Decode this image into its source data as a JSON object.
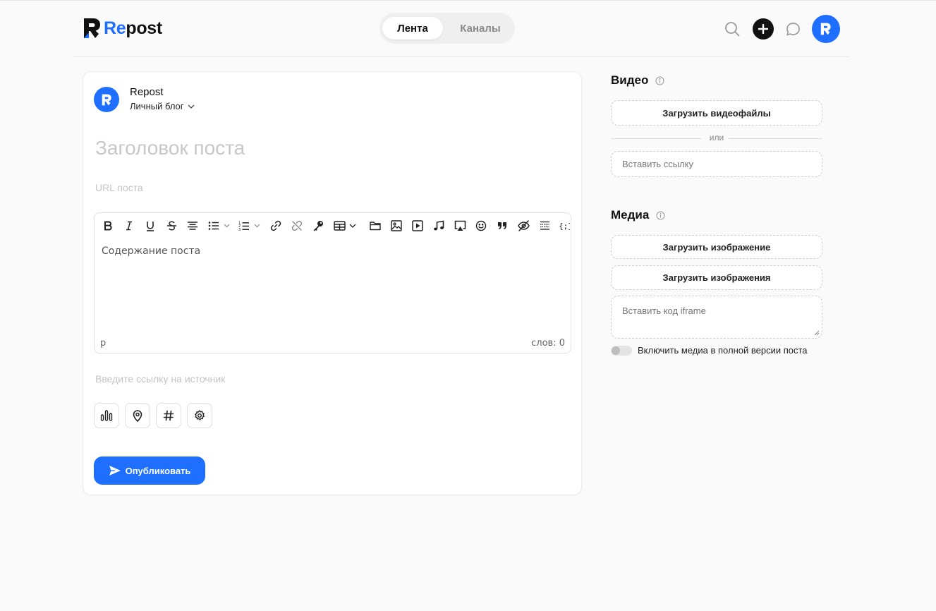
{
  "header": {
    "logo_re": "Re",
    "logo_post": "post",
    "tabs": [
      {
        "label": "Лента",
        "active": true
      },
      {
        "label": "Каналы",
        "active": false
      }
    ]
  },
  "editor_card": {
    "author_name": "Repost",
    "blog_select": "Личный блог",
    "title_placeholder": "Заголовок поста",
    "url_placeholder": "URL поста",
    "toolbar_icons": [
      "bold-icon",
      "italic-icon",
      "underline-icon",
      "strikethrough-icon",
      "align-center-icon",
      "bullet-list-icon",
      "numbered-list-icon",
      "link-icon",
      "unlink-icon",
      "key-icon",
      "table-icon",
      "folder-icon",
      "image-icon",
      "video-icon",
      "music-icon",
      "airplay-icon",
      "emoji-icon",
      "quote-icon",
      "hide-icon",
      "preformatted-icon",
      "code-icon"
    ],
    "content_placeholder": "Содержание поста",
    "status_path": "p",
    "word_count": "слов: 0",
    "source_placeholder": "Введите ссылку на источник",
    "option_icons": [
      "poll-icon",
      "location-icon",
      "hashtag-icon",
      "settings-icon"
    ],
    "publish_label": "Опубликовать"
  },
  "video_section": {
    "title": "Видео",
    "upload_label": "Загрузить видеофайлы",
    "or_label": "или",
    "link_placeholder": "Вставить ссылку"
  },
  "media_section": {
    "title": "Медиа",
    "upload_image_label": "Загрузить изображение",
    "upload_images_label": "Загрузить изображения",
    "iframe_placeholder": "Вставить код iframe",
    "toggle_label": "Включить медиа в полной версии поста",
    "toggle_on": false
  },
  "colors": {
    "accent": "#1e6fff",
    "background": "#fafafa"
  }
}
